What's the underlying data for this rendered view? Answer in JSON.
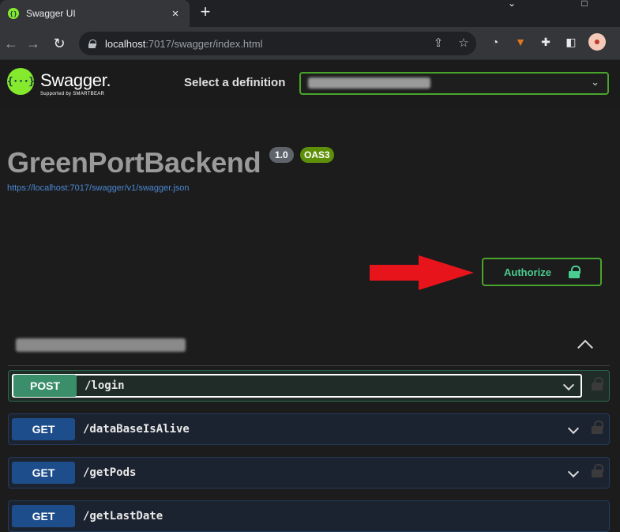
{
  "browser": {
    "tab_title": "Swagger UI",
    "tab_favicon": "swagger-favicon",
    "tab_close": "×",
    "new_tab": "+",
    "window_controls": [
      "minimize-icon",
      "restore-icon"
    ],
    "url_host": "localhost",
    "url_path": ":7017/swagger/index.html",
    "toolbar_icons": [
      "back-icon",
      "forward-icon",
      "reload-icon",
      "lock-icon",
      "share-icon",
      "star-icon"
    ],
    "extensions": [
      "ghostery-icon",
      "metamask-icon",
      "puzzle-icon",
      "sidepanel-icon",
      "profile-avatar"
    ]
  },
  "topbar": {
    "logo_glyph": "{···}",
    "logo_text": "Swagger.",
    "logo_subtext": "Supported by SMARTBEAR",
    "select_label": "Select a definition",
    "select_value_redacted": true
  },
  "info": {
    "title": "GreenPortBackend",
    "version": "1.0",
    "oas_badge": "OAS3",
    "spec_url": "https://localhost:7017/swagger/v1/swagger.json"
  },
  "authorize": {
    "label": "Authorize",
    "annotation": "red-arrow-pointing-at-authorize"
  },
  "tag": {
    "name_redacted": true,
    "expanded": true
  },
  "operations": [
    {
      "method": "POST",
      "path": "/login"
    },
    {
      "method": "GET",
      "path": "/dataBaseIsAlive"
    },
    {
      "method": "GET",
      "path": "/getPods"
    },
    {
      "method": "GET",
      "path": "/getLastDate"
    }
  ],
  "colors": {
    "swagger_green": "#85ea2d",
    "authorize_border": "#49a42c",
    "post_method": "#3a8f6a",
    "get_method": "#1d4d8a",
    "arrow": "#e8141c",
    "link": "#4b88d4"
  }
}
